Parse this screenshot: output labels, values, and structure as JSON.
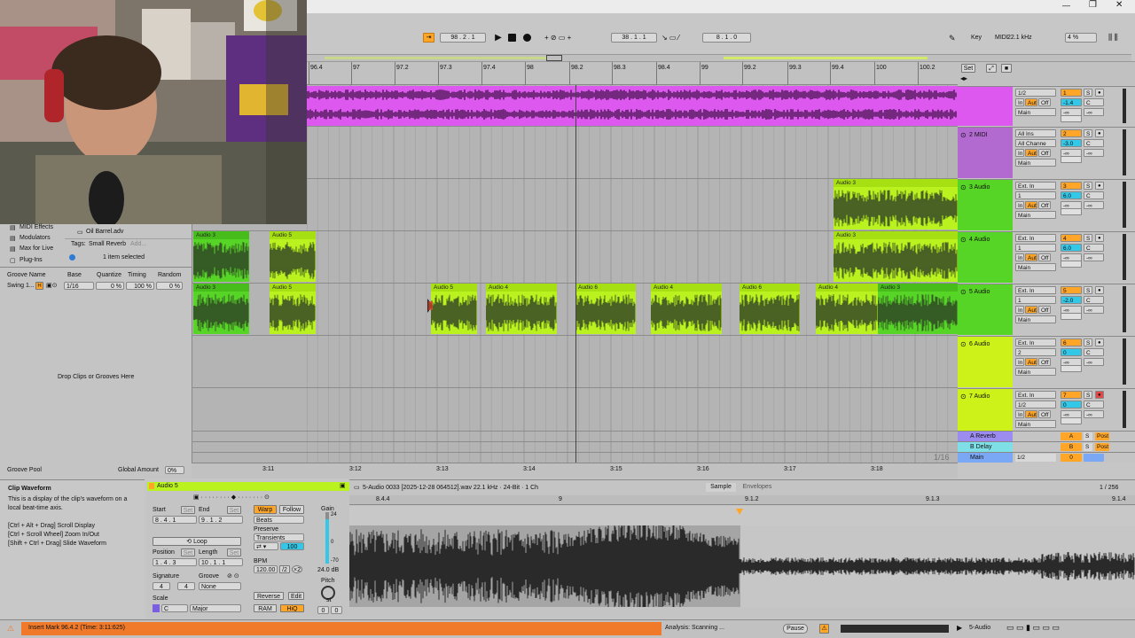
{
  "colors": {
    "accent": "#ffa629",
    "clip_green": "#b9f21e",
    "clip_dark": "#2e3d26",
    "magenta": "#dd58ee",
    "status_orange": "#f07a2a",
    "track_green": "#56d526",
    "track_yellow": "#cdf21a"
  },
  "transport": {
    "tempo": "98 . 2 . 1",
    "position": "38 . 1 . 1",
    "loop_length": "8 . 1 . 0",
    "key_label": "Key",
    "midi_label": "MIDI",
    "sample_rate": "22.1 kHz",
    "cpu": "4 %"
  },
  "ruler": {
    "bars": [
      "96.4",
      "97",
      "97.2",
      "97.3",
      "97.4",
      "98",
      "98.2",
      "98.3",
      "98.4",
      "99",
      "99.2",
      "99.3",
      "99.4",
      "100",
      "100.2"
    ],
    "times": [
      "3:11",
      "3:12",
      "3:13",
      "3:14",
      "3:15",
      "3:16",
      "3:17",
      "3:18"
    ],
    "zoom": "1/16",
    "set_label": "Set"
  },
  "browser": {
    "items": [
      "MIDI Effects",
      "Modulators",
      "Max for Live",
      "Plug-Ins"
    ],
    "selected_file": "Oil Barrel.adv",
    "tags_label": "Tags:",
    "tag": "Small Reverb",
    "add_tag": "Add...",
    "selection_status": "1 item selected"
  },
  "groove": {
    "headers": [
      "Groove Name",
      "Base",
      "Quantize",
      "Timing",
      "Random"
    ],
    "row": {
      "name": "Swing 1...",
      "base": "1/16",
      "quantize": "0 %",
      "timing": "100 %",
      "random": "0 %"
    },
    "drop_hint": "Drop Clips or Grooves Here",
    "pool_label": "Groove Pool",
    "global_amount_label": "Global Amount",
    "global_amount": "0%"
  },
  "tracks": [
    {
      "name": "",
      "vol": "-1.4",
      "num": "1",
      "io": [
        "1/2",
        "In",
        "Auto",
        "Off",
        "Main"
      ]
    },
    {
      "name": "2 MIDI",
      "vol": "-3.0",
      "num": "2",
      "io": [
        "All Ins",
        "All Channe",
        "In",
        "Auto",
        "Off",
        "Main"
      ]
    },
    {
      "name": "3 Audio",
      "vol": "6.0",
      "num": "3",
      "io": [
        "Ext. In",
        "1",
        "In",
        "Auto",
        "Off",
        "Main"
      ]
    },
    {
      "name": "4 Audio",
      "vol": "6.0",
      "num": "4",
      "io": [
        "Ext. In",
        "1",
        "In",
        "Auto",
        "Off",
        "Main"
      ]
    },
    {
      "name": "5 Audio",
      "vol": "-2.0",
      "num": "5",
      "io": [
        "Ext. In",
        "1",
        "In",
        "Auto",
        "Off",
        "Main"
      ]
    },
    {
      "name": "6 Audio",
      "vol": "0",
      "num": "6",
      "io": [
        "Ext. In",
        "2",
        "In",
        "Auto",
        "Off",
        "Main"
      ]
    },
    {
      "name": "7 Audio",
      "vol": "0",
      "num": "7",
      "io": [
        "Ext. In",
        "1/2",
        "In",
        "Auto",
        "Off",
        "Main"
      ]
    }
  ],
  "returns": [
    {
      "name": "A Reverb",
      "letter": "A"
    },
    {
      "name": "B Delay",
      "letter": "B"
    },
    {
      "name": "Main",
      "letter": "0"
    }
  ],
  "clip_names": {
    "a3": "Audio 3",
    "a4": "Audio 4",
    "a5": "Audio 5",
    "a6": "Audio 6"
  },
  "mixer": {
    "minus_inf": "-∞",
    "c": "C",
    "s": "S",
    "post": "Post",
    "main_route": "1/2"
  },
  "info": {
    "title": "Clip Waveform",
    "body": "This is a display of the clip's waveform on a local beat-time axis.",
    "shortcuts": [
      "[Ctrl + Alt + Drag] Scroll Display",
      "[Ctrl + Scroll Wheel] Zoom In/Out",
      "[Shift + Ctrl + Drag] Slide Waveform"
    ]
  },
  "clip": {
    "name": "Audio 5",
    "start_label": "Start",
    "end_label": "End",
    "set_label": "Set",
    "start": "8 . 4 . 1",
    "end": "9 . 1 . 2",
    "warp": "Warp",
    "follow": "Follow",
    "warp_mode": "Beats",
    "preserve_label": "Preserve",
    "preserve": "Transients",
    "loop": "Loop",
    "position_label": "Position",
    "length_label": "Length",
    "position": "1 . 4 . 3",
    "length": "10 . 1 . 1",
    "bpm_label": "BPM",
    "bpm": "120.00",
    "half": "/2",
    "double": "×2",
    "amount": "100",
    "signature_label": "Signature",
    "sig_num": "4",
    "sig_den": "4",
    "groove_label": "Groove",
    "groove": "None",
    "scale_label": "Scale",
    "scale_root": "C",
    "scale_mode": "Major",
    "reverse": "Reverse",
    "edit": "Edit",
    "ram": "RAM",
    "hiq": "HiQ",
    "gain_label": "Gain",
    "gain_top": "24",
    "gain_mid": "0",
    "gain_low": "-70",
    "gain_val": "24.0 dB",
    "pitch_label": "Pitch",
    "pitch_unit": "st",
    "pitch_a": "0",
    "pitch_b": "0"
  },
  "sample": {
    "file": "5-Audio 0033 [2025-12-28 064512].wav  22.1 kHz · 24-Bit · 1 Ch",
    "tab_sample": "Sample",
    "tab_env": "Envelopes",
    "page": "1 / 256",
    "ruler": [
      "8.4.4",
      "9",
      "9.1.2",
      "9.1.3",
      "9.1.4"
    ]
  },
  "status": {
    "message": "Insert Mark 96.4.2 (Time: 3:11:625)",
    "analysis": "Analysis: Scanning ...",
    "pause": "Pause",
    "track": "5-Audio"
  }
}
